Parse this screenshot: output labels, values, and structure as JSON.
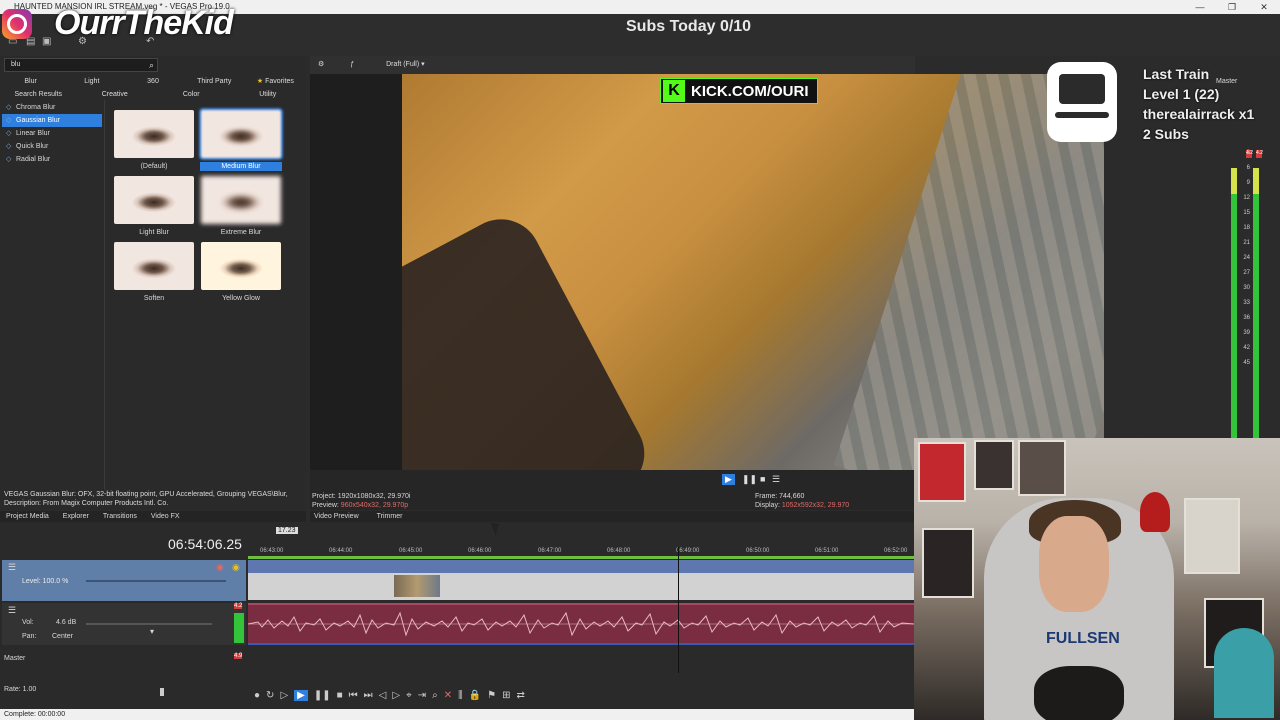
{
  "window": {
    "title": "HAUNTED MANSION IRL STREAM.veg * - VEGAS Pro 19.0",
    "controls": [
      "—",
      "❐",
      "✕"
    ]
  },
  "overlay": {
    "brand": "OurrTheKid",
    "subs_today": "Subs Today 0/10",
    "kick": "KICK.COM/OURI",
    "train": {
      "line1": "Last Train",
      "line2": "Level 1  (22)",
      "line3": "therealairrack x1",
      "line4": "2 Subs"
    },
    "webcam_shirt": "FULLSEN"
  },
  "fx_panel": {
    "search_value": "blu",
    "tabs_row1": [
      "Blur",
      "Light",
      "360",
      "Third Party",
      "Favorites"
    ],
    "tabs_row2": [
      "Search Results",
      "Creative",
      "Color",
      "Utility"
    ],
    "effects": [
      "Chroma Blur",
      "Gaussian Blur",
      "Linear Blur",
      "Quick Blur",
      "Radial Blur"
    ],
    "presets": [
      "(Default)",
      "Medium Blur",
      "Light Blur",
      "Extreme Blur",
      "Soften",
      "Yellow Glow"
    ],
    "description_line1": "VEGAS Gaussian Blur: OFX, 32-bit floating point, GPU Accelerated, Grouping VEGAS\\Blur,",
    "description_line2": "Description: From Magix Computer Products Intl. Co.",
    "bottom_tabs": [
      "Project Media",
      "Explorer",
      "Transitions",
      "Video FX"
    ]
  },
  "preview": {
    "quality": "Draft (Full)",
    "project_label": "Project:",
    "project_value": "1920x1080x32, 29.970i",
    "preview_label": "Preview:",
    "preview_value": "960x540x32, 29.970p",
    "frame_label": "Frame:",
    "frame_value": "744,660",
    "display_label": "Display:",
    "display_value": "1052x592x32, 29.970",
    "tabs": [
      "Video Preview",
      "Trimmer"
    ]
  },
  "meters": {
    "title": "Master",
    "peak_left": "4.2",
    "peak_right": "4.2",
    "scale": [
      "3",
      "6",
      "9",
      "12",
      "15",
      "18",
      "21",
      "24",
      "27",
      "30",
      "33",
      "36",
      "39",
      "42",
      "45"
    ]
  },
  "timeline": {
    "timecode": "06:54:06.25",
    "ruler": [
      "06:43:00",
      "06:44:00",
      "06:45:00",
      "06:46:00",
      "06:47:00",
      "06:48:00",
      "06:49:00",
      "06:50:00",
      "06:51:00",
      "06:52:00"
    ],
    "video_track": {
      "level_label": "Level: 100.0 %"
    },
    "audio_track": {
      "vol_label": "Vol:",
      "vol_value": "4.6 dB",
      "pan_label": "Pan:",
      "pan_value": "Center",
      "peak": "4.2"
    },
    "master_label": "Master",
    "master_peak": "4.9",
    "rate_label": "Rate: 1.00",
    "loop_marker": "17.23"
  },
  "status": {
    "text": "Complete: 00:00:00"
  },
  "colors": {
    "accent": "#2f7fde",
    "kick_green": "#53fc18",
    "audio_clip": "#7a2c40",
    "video_header": "#5e77b0",
    "meter_green": "#33c43a"
  }
}
